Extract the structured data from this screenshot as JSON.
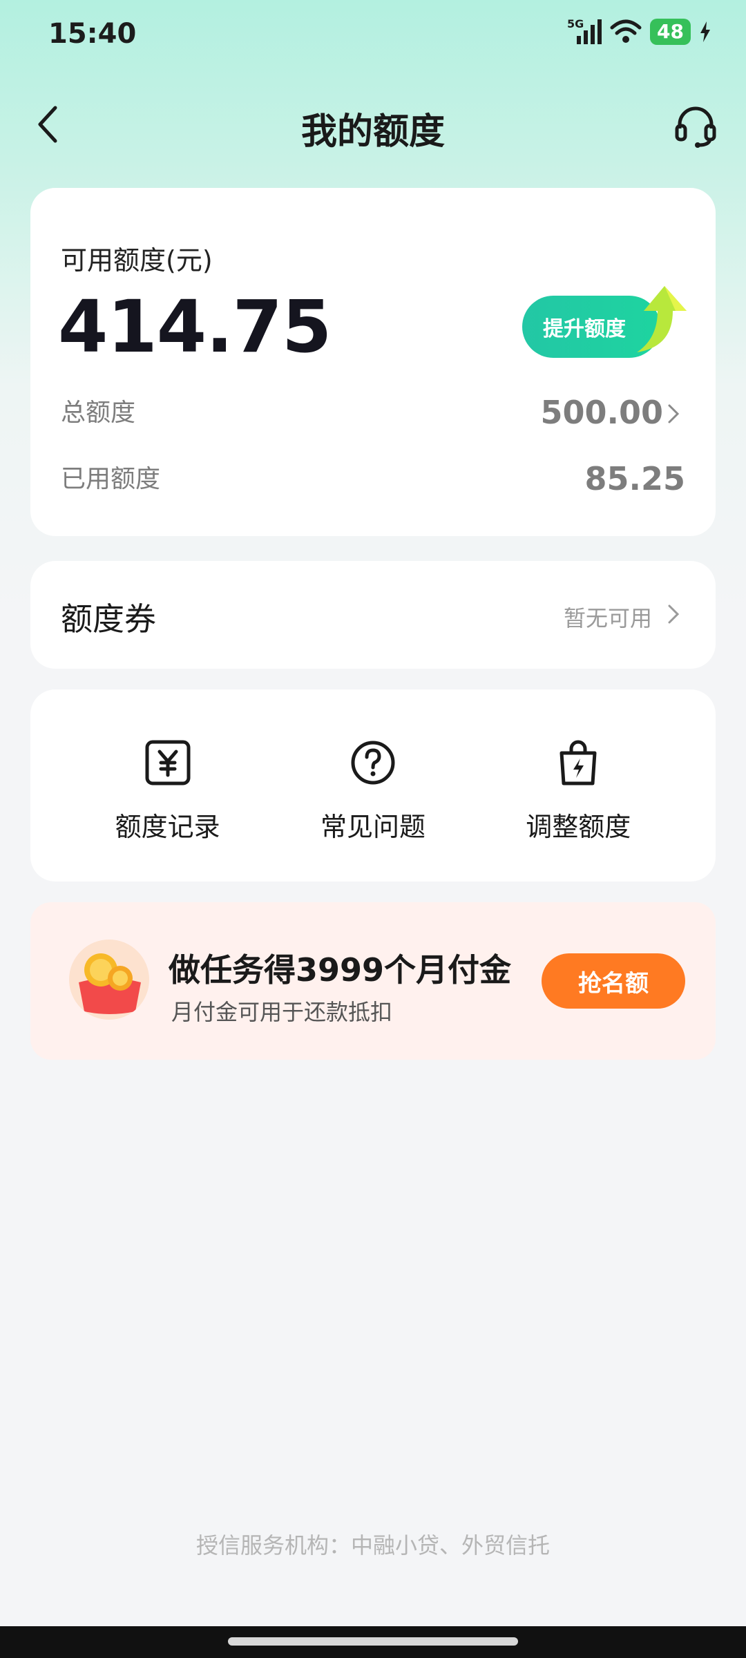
{
  "status": {
    "time": "15:40",
    "network": "5G",
    "battery": "48"
  },
  "nav": {
    "title": "我的额度",
    "back_icon": "chevron-left-icon",
    "service_icon": "headset-icon"
  },
  "credit": {
    "available_label": "可用额度(元)",
    "available_value": "414.75",
    "raise_button": "提升额度",
    "total_label": "总额度",
    "total_value": "500.00",
    "used_label": "已用额度",
    "used_value": "85.25"
  },
  "coupon": {
    "label": "额度券",
    "status": "暂无可用"
  },
  "tools": [
    {
      "label": "额度记录",
      "icon": "yuan-record-icon"
    },
    {
      "label": "常见问题",
      "icon": "question-circle-icon"
    },
    {
      "label": "调整额度",
      "icon": "bag-bolt-icon"
    }
  ],
  "promo": {
    "title": "做任务得3999个月付金",
    "subtitle": "月付金可用于还款抵扣",
    "button": "抢名额"
  },
  "footer": {
    "text": "授信服务机构：中融小贷、外贸信托"
  },
  "colors": {
    "accent": "#1ed4a0",
    "promo_button": "#ff7a22",
    "battery": "#36c05a"
  }
}
